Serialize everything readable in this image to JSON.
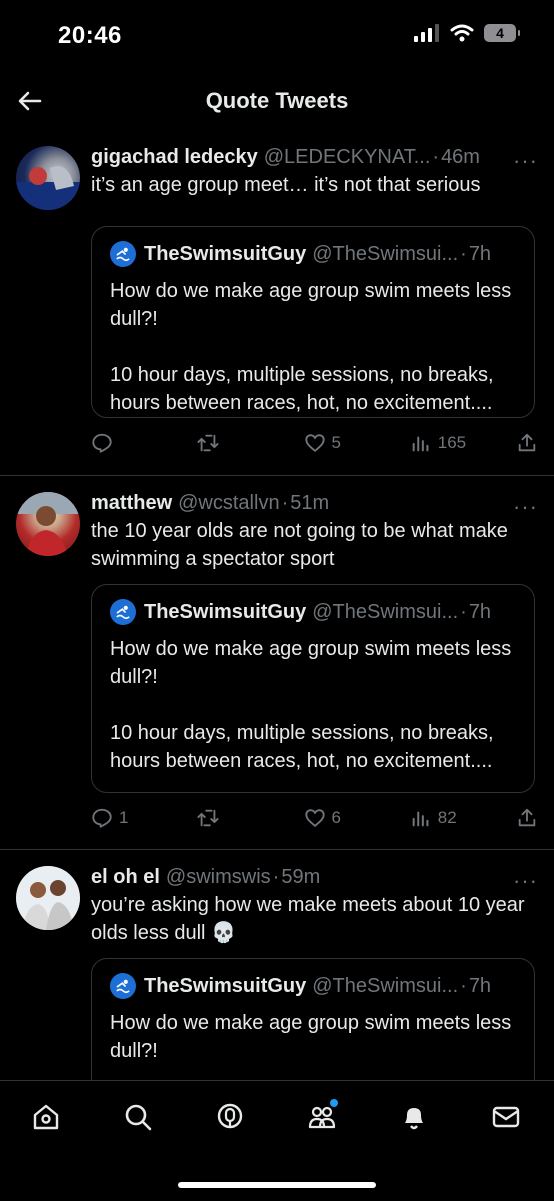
{
  "status_bar": {
    "time": "20:46",
    "battery": "4"
  },
  "header": {
    "title": "Quote Tweets"
  },
  "quoted_tweet": {
    "name": "TheSwimsuitGuy",
    "handle": "@TheSwimsui...",
    "time": "7h",
    "text_full": "How do we make age group swim meets less dull?!\n\n10 hour days, multiple sessions, no breaks, hours between races, hot, no excitement....",
    "text_short": "How do we make age group swim meets less dull?!"
  },
  "tweets": [
    {
      "name": "gigachad ledecky",
      "handle": "@LEDECKYNAT...",
      "time": "46m",
      "text": "it’s an age group meet… it’s not that serious",
      "replies": "",
      "likes": "5",
      "views": "165"
    },
    {
      "name": "matthew",
      "handle": "@wcstallvn",
      "time": "51m",
      "text": "the 10 year olds are not going to be what make swimming a spectator sport",
      "replies": "1",
      "likes": "6",
      "views": "82"
    },
    {
      "name": "el oh el",
      "handle": "@swimswis",
      "time": "59m",
      "text": "you’re asking how we make meets about 10 year olds less dull 💀"
    }
  ],
  "ui": {
    "dot": "·",
    "more": "···"
  },
  "colors": {
    "background": "#000000",
    "text": "#e7e9ea",
    "secondary": "#71767b",
    "border": "#2f3336",
    "accent": "#1d9bf0"
  },
  "icons": [
    "back-arrow-icon",
    "reply-icon",
    "retweet-icon",
    "like-icon",
    "views-icon",
    "share-icon",
    "home-icon",
    "search-icon",
    "spaces-icon",
    "communities-icon",
    "notifications-icon",
    "messages-icon"
  ]
}
